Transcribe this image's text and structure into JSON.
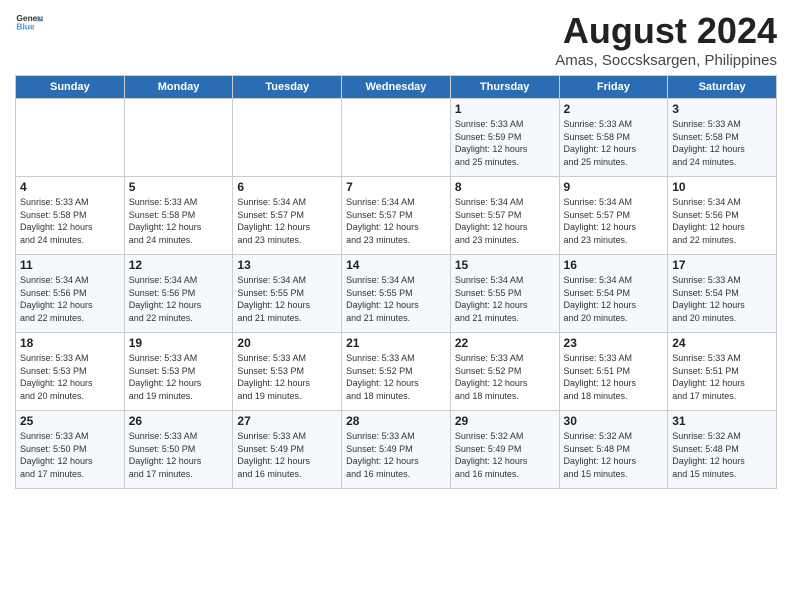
{
  "logo": {
    "text_general": "General",
    "text_blue": "Blue"
  },
  "title": "August 2024",
  "subtitle": "Amas, Soccsksargen, Philippines",
  "header": {
    "days": [
      "Sunday",
      "Monday",
      "Tuesday",
      "Wednesday",
      "Thursday",
      "Friday",
      "Saturday"
    ]
  },
  "weeks": [
    {
      "cells": [
        {
          "day": "",
          "info": ""
        },
        {
          "day": "",
          "info": ""
        },
        {
          "day": "",
          "info": ""
        },
        {
          "day": "",
          "info": ""
        },
        {
          "day": "1",
          "info": "Sunrise: 5:33 AM\nSunset: 5:59 PM\nDaylight: 12 hours\nand 25 minutes."
        },
        {
          "day": "2",
          "info": "Sunrise: 5:33 AM\nSunset: 5:58 PM\nDaylight: 12 hours\nand 25 minutes."
        },
        {
          "day": "3",
          "info": "Sunrise: 5:33 AM\nSunset: 5:58 PM\nDaylight: 12 hours\nand 24 minutes."
        }
      ]
    },
    {
      "cells": [
        {
          "day": "4",
          "info": "Sunrise: 5:33 AM\nSunset: 5:58 PM\nDaylight: 12 hours\nand 24 minutes."
        },
        {
          "day": "5",
          "info": "Sunrise: 5:33 AM\nSunset: 5:58 PM\nDaylight: 12 hours\nand 24 minutes."
        },
        {
          "day": "6",
          "info": "Sunrise: 5:34 AM\nSunset: 5:57 PM\nDaylight: 12 hours\nand 23 minutes."
        },
        {
          "day": "7",
          "info": "Sunrise: 5:34 AM\nSunset: 5:57 PM\nDaylight: 12 hours\nand 23 minutes."
        },
        {
          "day": "8",
          "info": "Sunrise: 5:34 AM\nSunset: 5:57 PM\nDaylight: 12 hours\nand 23 minutes."
        },
        {
          "day": "9",
          "info": "Sunrise: 5:34 AM\nSunset: 5:57 PM\nDaylight: 12 hours\nand 23 minutes."
        },
        {
          "day": "10",
          "info": "Sunrise: 5:34 AM\nSunset: 5:56 PM\nDaylight: 12 hours\nand 22 minutes."
        }
      ]
    },
    {
      "cells": [
        {
          "day": "11",
          "info": "Sunrise: 5:34 AM\nSunset: 5:56 PM\nDaylight: 12 hours\nand 22 minutes."
        },
        {
          "day": "12",
          "info": "Sunrise: 5:34 AM\nSunset: 5:56 PM\nDaylight: 12 hours\nand 22 minutes."
        },
        {
          "day": "13",
          "info": "Sunrise: 5:34 AM\nSunset: 5:55 PM\nDaylight: 12 hours\nand 21 minutes."
        },
        {
          "day": "14",
          "info": "Sunrise: 5:34 AM\nSunset: 5:55 PM\nDaylight: 12 hours\nand 21 minutes."
        },
        {
          "day": "15",
          "info": "Sunrise: 5:34 AM\nSunset: 5:55 PM\nDaylight: 12 hours\nand 21 minutes."
        },
        {
          "day": "16",
          "info": "Sunrise: 5:34 AM\nSunset: 5:54 PM\nDaylight: 12 hours\nand 20 minutes."
        },
        {
          "day": "17",
          "info": "Sunrise: 5:33 AM\nSunset: 5:54 PM\nDaylight: 12 hours\nand 20 minutes."
        }
      ]
    },
    {
      "cells": [
        {
          "day": "18",
          "info": "Sunrise: 5:33 AM\nSunset: 5:53 PM\nDaylight: 12 hours\nand 20 minutes."
        },
        {
          "day": "19",
          "info": "Sunrise: 5:33 AM\nSunset: 5:53 PM\nDaylight: 12 hours\nand 19 minutes."
        },
        {
          "day": "20",
          "info": "Sunrise: 5:33 AM\nSunset: 5:53 PM\nDaylight: 12 hours\nand 19 minutes."
        },
        {
          "day": "21",
          "info": "Sunrise: 5:33 AM\nSunset: 5:52 PM\nDaylight: 12 hours\nand 18 minutes."
        },
        {
          "day": "22",
          "info": "Sunrise: 5:33 AM\nSunset: 5:52 PM\nDaylight: 12 hours\nand 18 minutes."
        },
        {
          "day": "23",
          "info": "Sunrise: 5:33 AM\nSunset: 5:51 PM\nDaylight: 12 hours\nand 18 minutes."
        },
        {
          "day": "24",
          "info": "Sunrise: 5:33 AM\nSunset: 5:51 PM\nDaylight: 12 hours\nand 17 minutes."
        }
      ]
    },
    {
      "cells": [
        {
          "day": "25",
          "info": "Sunrise: 5:33 AM\nSunset: 5:50 PM\nDaylight: 12 hours\nand 17 minutes."
        },
        {
          "day": "26",
          "info": "Sunrise: 5:33 AM\nSunset: 5:50 PM\nDaylight: 12 hours\nand 17 minutes."
        },
        {
          "day": "27",
          "info": "Sunrise: 5:33 AM\nSunset: 5:49 PM\nDaylight: 12 hours\nand 16 minutes."
        },
        {
          "day": "28",
          "info": "Sunrise: 5:33 AM\nSunset: 5:49 PM\nDaylight: 12 hours\nand 16 minutes."
        },
        {
          "day": "29",
          "info": "Sunrise: 5:32 AM\nSunset: 5:49 PM\nDaylight: 12 hours\nand 16 minutes."
        },
        {
          "day": "30",
          "info": "Sunrise: 5:32 AM\nSunset: 5:48 PM\nDaylight: 12 hours\nand 15 minutes."
        },
        {
          "day": "31",
          "info": "Sunrise: 5:32 AM\nSunset: 5:48 PM\nDaylight: 12 hours\nand 15 minutes."
        }
      ]
    }
  ]
}
